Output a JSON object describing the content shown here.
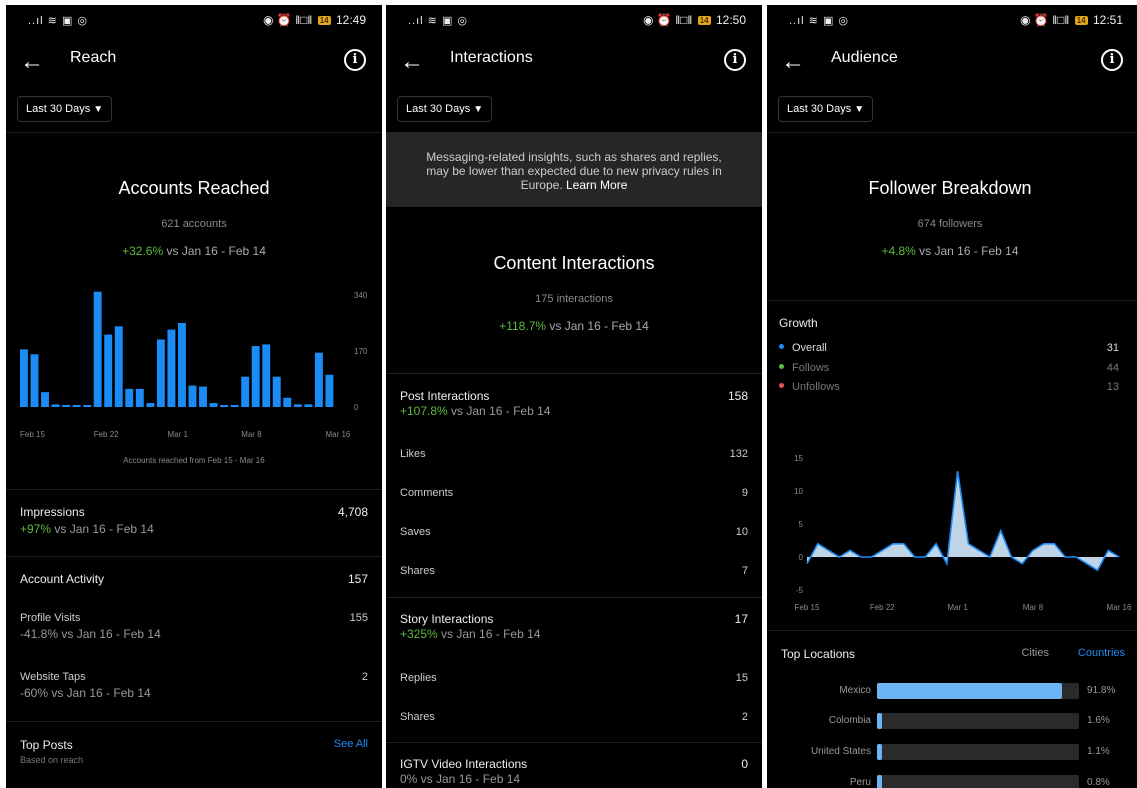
{
  "colors": {
    "accent": "#1b8cf5",
    "positive": "#5dbb3d",
    "overall": "#1b8cf5",
    "follows": "#5dbb3d",
    "unfollows": "#e35454"
  },
  "statusbar": [
    {
      "left": "..ıl ≋ ▣ ◎",
      "right_icons": "◉ ⏰ ‖□‖",
      "battery": "14",
      "time": "12:49"
    },
    {
      "left": "..ıl ≋ ▣ ◎",
      "right_icons": "◉ ⏰ ‖□‖",
      "battery": "14",
      "time": "12:50"
    },
    {
      "left": "..ıl ≋ ▣ ◎",
      "right_icons": "◉ ⏰ ‖□‖",
      "battery": "14",
      "time": "12:51"
    }
  ],
  "reach": {
    "title": "Reach",
    "range": "Last 30 Days",
    "hero": {
      "heading": "Accounts Reached",
      "sub": "621 accounts",
      "change": "+32.6%",
      "change_rest": " vs Jan 16 - Feb 14"
    },
    "chart_data": {
      "type": "bar",
      "categories": [
        "Feb 15",
        "Feb 16",
        "Feb 17",
        "Feb 18",
        "Feb 19",
        "Feb 20",
        "Feb 21",
        "Feb 22",
        "Feb 23",
        "Feb 24",
        "Feb 25",
        "Feb 26",
        "Feb 27",
        "Feb 28",
        "Mar 1",
        "Mar 2",
        "Mar 3",
        "Mar 4",
        "Mar 5",
        "Mar 6",
        "Mar 7",
        "Mar 8",
        "Mar 9",
        "Mar 10",
        "Mar 11",
        "Mar 12",
        "Mar 13",
        "Mar 14",
        "Mar 15",
        "Mar 16"
      ],
      "values": [
        175,
        160,
        45,
        8,
        5,
        5,
        5,
        350,
        220,
        245,
        55,
        55,
        12,
        205,
        235,
        255,
        65,
        62,
        12,
        6,
        5,
        92,
        185,
        190,
        92,
        28,
        8,
        8,
        165,
        98
      ],
      "ylim": [
        0,
        340
      ],
      "yticks": [
        "340",
        "170",
        "0"
      ],
      "xticks": [
        "Feb 15",
        "Feb 22",
        "Mar 1",
        "Mar 8",
        "Mar 16"
      ],
      "caption": "Accounts reached from Feb 15 - Mar 16"
    },
    "impressions": {
      "label": "Impressions",
      "value": "4,708",
      "change": "+97%",
      "change_rest": " vs Jan 16 - Feb 14"
    },
    "activity": {
      "label": "Account Activity",
      "value": "157"
    },
    "profile_visits": {
      "label": "Profile Visits",
      "value": "155",
      "change": "-41.8% vs Jan 16 - Feb 14"
    },
    "website_taps": {
      "label": "Website Taps",
      "value": "2",
      "change": "-60% vs Jan 16 - Feb 14"
    },
    "top_posts": {
      "label": "Top Posts",
      "sub": "Based on reach",
      "link": "See All"
    }
  },
  "interactions": {
    "title": "Interactions",
    "range": "Last 30 Days",
    "notice": "Messaging-related insights, such as shares and replies, may be lower than expected due to new privacy rules in Europe.",
    "learn_more": "Learn More",
    "hero": {
      "heading": "Content Interactions",
      "sub": "175 interactions",
      "change": "+118.7%",
      "change_rest": " vs Jan 16 - Feb 14"
    },
    "post": {
      "label": "Post Interactions",
      "value": "158",
      "change": "+107.8%",
      "change_rest": " vs Jan 16 - Feb 14"
    },
    "post_items": [
      {
        "label": "Likes",
        "value": "132"
      },
      {
        "label": "Comments",
        "value": "9"
      },
      {
        "label": "Saves",
        "value": "10"
      },
      {
        "label": "Shares",
        "value": "7"
      }
    ],
    "story": {
      "label": "Story Interactions",
      "value": "17",
      "change": "+325%",
      "change_rest": " vs Jan 16 - Feb 14"
    },
    "story_items": [
      {
        "label": "Replies",
        "value": "15"
      },
      {
        "label": "Shares",
        "value": "2"
      }
    ],
    "igtv": {
      "label": "IGTV Video Interactions",
      "value": "0",
      "change": "0% vs Jan 16 - Feb 14"
    }
  },
  "audience": {
    "title": "Audience",
    "range": "Last 30 Days",
    "hero": {
      "heading": "Follower Breakdown",
      "sub": "674 followers",
      "change": "+4.8%",
      "change_rest": " vs Jan 16 - Feb 14"
    },
    "growth": {
      "label": "Growth",
      "overall_label": "Overall",
      "overall": "31",
      "follows_label": "Follows",
      "follows": "44",
      "unfollows_label": "Unfollows",
      "unfollows": "13"
    },
    "chart_data": {
      "type": "area",
      "x": [
        "Feb 15",
        "Feb 16",
        "Feb 17",
        "Feb 18",
        "Feb 19",
        "Feb 20",
        "Feb 21",
        "Feb 22",
        "Feb 23",
        "Feb 24",
        "Feb 25",
        "Feb 26",
        "Feb 27",
        "Feb 28",
        "Mar 1",
        "Mar 2",
        "Mar 3",
        "Mar 4",
        "Mar 5",
        "Mar 6",
        "Mar 7",
        "Mar 8",
        "Mar 9",
        "Mar 10",
        "Mar 11",
        "Mar 12",
        "Mar 13",
        "Mar 14",
        "Mar 15",
        "Mar 16"
      ],
      "values": [
        -1,
        2,
        1,
        0,
        1,
        0,
        0,
        1,
        2,
        2,
        0,
        0,
        2,
        -1,
        13,
        2,
        1,
        0,
        4,
        0,
        -1,
        1,
        2,
        2,
        0,
        0,
        -1,
        -2,
        1,
        0
      ],
      "ylim": [
        -5,
        15
      ],
      "yticks": [
        "15",
        "10",
        "5",
        "0",
        "-5"
      ],
      "xticks": [
        "Feb 15",
        "Feb 22",
        "Mar 1",
        "Mar 8",
        "Mar 16"
      ]
    },
    "locations": {
      "label": "Top Locations",
      "tab_cities": "Cities",
      "tab_countries": "Countries",
      "items": [
        {
          "name": "Mexico",
          "value": 0.918,
          "pct": "91.8%"
        },
        {
          "name": "Colombia",
          "value": 0.016,
          "pct": "1.6%"
        },
        {
          "name": "United States",
          "value": 0.011,
          "pct": "1.1%"
        },
        {
          "name": "Peru",
          "value": 0.008,
          "pct": "0.8%"
        }
      ]
    }
  }
}
